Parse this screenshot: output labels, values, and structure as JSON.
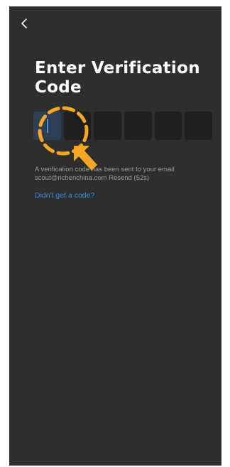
{
  "header": {
    "back_icon": "chevron-left-icon"
  },
  "main": {
    "title": "Enter Verification Code",
    "code_boxes": [
      "",
      "",
      "",
      "",
      "",
      ""
    ],
    "active_index": 0,
    "message_line1": "A verification code has been sent to your email",
    "message_line2": "scout@richenchina.com Resend (52s)",
    "help_link": "Didn't get a code?"
  },
  "annotation": {
    "type": "dashed-circle-with-arrow",
    "color": "#f5a623"
  },
  "colors": {
    "background": "#2e2e2e",
    "code_box": "#1e1e1e",
    "active_box": "#2f3d55",
    "link": "#3b8ddc",
    "text_muted": "#9a9a9a"
  }
}
